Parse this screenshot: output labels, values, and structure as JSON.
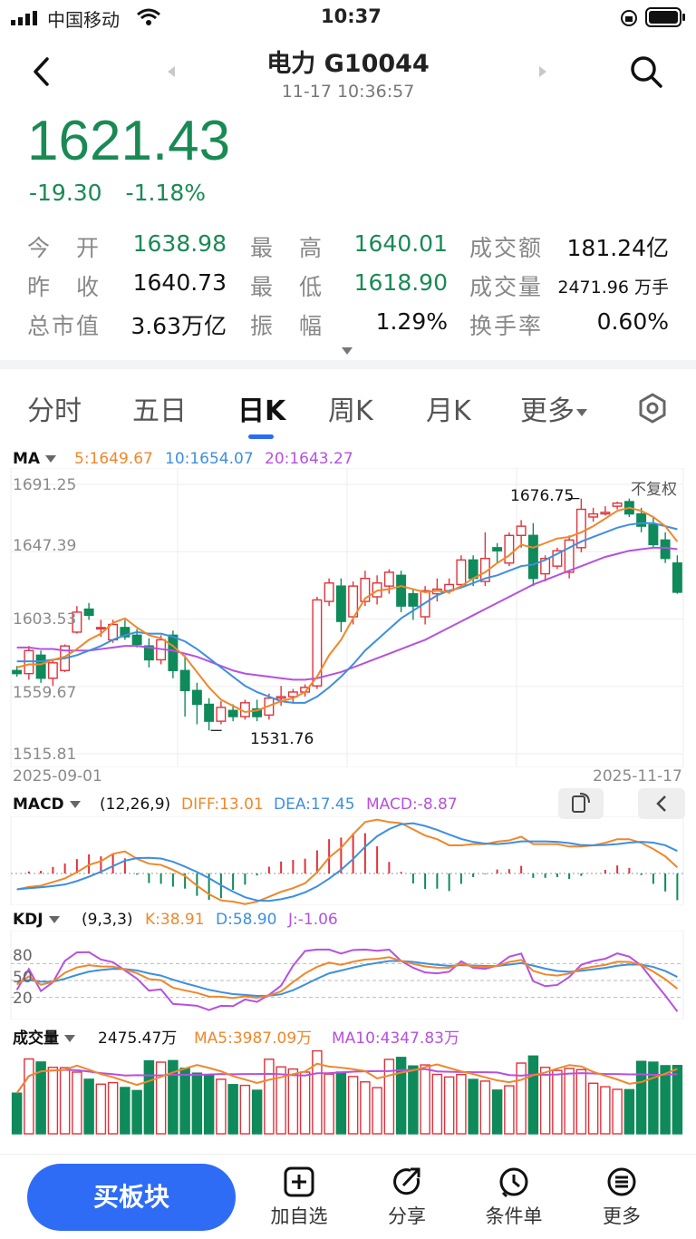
{
  "status_bar": {
    "carrier": "中国移动",
    "time": "10:37"
  },
  "header": {
    "title": "电力 G10044",
    "datetime": "11-17 10:36:57"
  },
  "quote": {
    "price": "1621.43",
    "change": "-19.30",
    "change_pct": "-1.18%",
    "color_down": "#1a8a55",
    "color_up": "#e53935"
  },
  "stats": [
    {
      "label": "今　开",
      "value": "1638.98",
      "color": "green"
    },
    {
      "label": "最　高",
      "value": "1640.01",
      "color": "green"
    },
    {
      "label": "成交额",
      "value": "181.24亿",
      "color": "black"
    },
    {
      "label": "昨　收",
      "value": "1640.73",
      "color": "black"
    },
    {
      "label": "最　低",
      "value": "1618.90",
      "color": "green"
    },
    {
      "label": "成交量",
      "value": "2471.96 万手",
      "color": "black"
    },
    {
      "label": "总市值",
      "value": "3.63万亿",
      "color": "black"
    },
    {
      "label": "振　幅",
      "value": "1.29%",
      "color": "black"
    },
    {
      "label": "换手率",
      "value": "0.60%",
      "color": "black"
    }
  ],
  "tabs": [
    "分时",
    "五日",
    "日K",
    "周K",
    "月K",
    "更多"
  ],
  "active_tab": "日K",
  "ma_legend": {
    "tag": "MA",
    "ma5": "5:1649.67",
    "ma10": "10:1654.07",
    "ma20": "20:1643.27"
  },
  "price_axis": [
    "1691.25",
    "1647.39",
    "1603.53",
    "1559.67",
    "1515.81"
  ],
  "date_axis": {
    "start": "2025-09-01",
    "end": "2025-11-17"
  },
  "fuquan": "不复权",
  "annotations": {
    "high": "1676.75",
    "low": "1531.76"
  },
  "macd_legend": {
    "tag": "MACD",
    "params": "(12,26,9)",
    "diff": "DIFF:13.01",
    "dea": "DEA:17.45",
    "macd": "MACD:-8.87"
  },
  "kdj_legend": {
    "tag": "KDJ",
    "params": "(9,3,3)",
    "k": "K:38.91",
    "d": "D:58.90",
    "j": "J:-1.06"
  },
  "kdj_axis": [
    "80",
    "50",
    "20"
  ],
  "vol_legend": {
    "tag": "成交量",
    "vol": "2475.47万",
    "ma5": "MA5:3987.09万",
    "ma10": "MA10:4347.83万"
  },
  "bottom_bar": {
    "buy_label": "买板块",
    "items": [
      {
        "label": "加自选",
        "icon": "plus-square-icon"
      },
      {
        "label": "分享",
        "icon": "share-icon"
      },
      {
        "label": "条件单",
        "icon": "clock-icon"
      },
      {
        "label": "更多",
        "icon": "menu-icon"
      }
    ]
  },
  "colors": {
    "ma5": "#f0872a",
    "ma10": "#3d8fe0",
    "ma20": "#b650e0",
    "up": "#e0323b",
    "down": "#0f8a5a"
  },
  "chart_data": {
    "type": "candlestick",
    "ylim": [
      1515.81,
      1691.25
    ],
    "candles": [
      [
        1570,
        1573,
        1566,
        1568
      ],
      [
        1568,
        1586,
        1564,
        1583
      ],
      [
        1580,
        1583,
        1562,
        1565
      ],
      [
        1565,
        1577,
        1560,
        1575
      ],
      [
        1570,
        1587,
        1569,
        1586
      ],
      [
        1595,
        1612,
        1594,
        1608
      ],
      [
        1610,
        1614,
        1603,
        1606
      ],
      [
        1598,
        1603,
        1592,
        1598
      ],
      [
        1590,
        1603,
        1588,
        1600
      ],
      [
        1598,
        1603,
        1590,
        1592
      ],
      [
        1593,
        1597,
        1585,
        1587
      ],
      [
        1586,
        1591,
        1572,
        1577
      ],
      [
        1577,
        1593,
        1574,
        1590
      ],
      [
        1593,
        1596,
        1565,
        1570
      ],
      [
        1570,
        1580,
        1540,
        1557
      ],
      [
        1557,
        1562,
        1535,
        1548
      ],
      [
        1548,
        1552,
        1531,
        1537
      ],
      [
        1537,
        1550,
        1535,
        1546
      ],
      [
        1544,
        1548,
        1537,
        1540
      ],
      [
        1540,
        1551,
        1538,
        1549
      ],
      [
        1545,
        1551,
        1537,
        1540
      ],
      [
        1541,
        1555,
        1538,
        1552
      ],
      [
        1552,
        1560,
        1547,
        1553
      ],
      [
        1553,
        1558,
        1549,
        1556
      ],
      [
        1556,
        1561,
        1553,
        1559
      ],
      [
        1560,
        1618,
        1558,
        1616
      ],
      [
        1615,
        1630,
        1612,
        1627
      ],
      [
        1625,
        1630,
        1595,
        1602
      ],
      [
        1605,
        1628,
        1600,
        1625
      ],
      [
        1615,
        1635,
        1612,
        1630
      ],
      [
        1618,
        1632,
        1613,
        1627
      ],
      [
        1625,
        1636,
        1620,
        1634
      ],
      [
        1632,
        1635,
        1608,
        1612
      ],
      [
        1620,
        1623,
        1603,
        1612
      ],
      [
        1605,
        1625,
        1600,
        1622
      ],
      [
        1620,
        1630,
        1615,
        1623
      ],
      [
        1622,
        1630,
        1620,
        1626
      ],
      [
        1626,
        1645,
        1624,
        1642
      ],
      [
        1642,
        1645,
        1625,
        1630
      ],
      [
        1628,
        1660,
        1625,
        1643
      ],
      [
        1650,
        1653,
        1640,
        1648
      ],
      [
        1640,
        1660,
        1638,
        1658
      ],
      [
        1658,
        1668,
        1650,
        1664
      ],
      [
        1658,
        1666,
        1625,
        1630
      ],
      [
        1633,
        1645,
        1628,
        1643
      ],
      [
        1638,
        1650,
        1636,
        1648
      ],
      [
        1634,
        1658,
        1630,
        1655
      ],
      [
        1650,
        1682,
        1647,
        1675
      ],
      [
        1670,
        1676,
        1667,
        1672
      ],
      [
        1672,
        1677,
        1671,
        1673
      ],
      [
        1677,
        1680,
        1675,
        1679
      ],
      [
        1680,
        1682,
        1670,
        1672
      ],
      [
        1672,
        1676,
        1660,
        1664
      ],
      [
        1665,
        1670,
        1650,
        1652
      ],
      [
        1655,
        1660,
        1640,
        1643
      ],
      [
        1640,
        1645,
        1620,
        1621
      ]
    ],
    "ma5": [
      1572,
      1574,
      1574,
      1577,
      1579,
      1584,
      1590,
      1594,
      1601,
      1604,
      1598,
      1593,
      1591,
      1586,
      1579,
      1569,
      1559,
      1551,
      1547,
      1543,
      1544,
      1547,
      1550,
      1552,
      1556,
      1566,
      1580,
      1590,
      1604,
      1617,
      1622,
      1623,
      1625,
      1623,
      1621,
      1622,
      1621,
      1625,
      1630,
      1634,
      1640,
      1645,
      1652,
      1650,
      1653,
      1656,
      1657,
      1660,
      1664,
      1669,
      1674,
      1676,
      1674,
      1670,
      1664,
      1654
    ],
    "ma10": [
      1576,
      1576,
      1576,
      1577,
      1578,
      1580,
      1583,
      1586,
      1590,
      1593,
      1595,
      1594,
      1594,
      1592,
      1589,
      1584,
      1578,
      1572,
      1566,
      1560,
      1556,
      1553,
      1550,
      1549,
      1549,
      1553,
      1559,
      1566,
      1574,
      1583,
      1590,
      1597,
      1604,
      1609,
      1614,
      1619,
      1622,
      1624,
      1627,
      1630,
      1632,
      1635,
      1638,
      1639,
      1642,
      1646,
      1650,
      1654,
      1657,
      1660,
      1663,
      1665,
      1666,
      1666,
      1664,
      1662
    ],
    "ma20": [
      1585,
      1585,
      1584,
      1584,
      1583,
      1583,
      1583,
      1584,
      1585,
      1586,
      1586,
      1585,
      1584,
      1583,
      1581,
      1579,
      1576,
      1573,
      1570,
      1568,
      1567,
      1566,
      1565,
      1564,
      1564,
      1565,
      1567,
      1569,
      1572,
      1575,
      1578,
      1581,
      1584,
      1587,
      1590,
      1594,
      1598,
      1602,
      1606,
      1610,
      1614,
      1618,
      1622,
      1626,
      1629,
      1632,
      1635,
      1638,
      1641,
      1644,
      1646,
      1648,
      1649,
      1650,
      1650,
      1649
    ]
  }
}
